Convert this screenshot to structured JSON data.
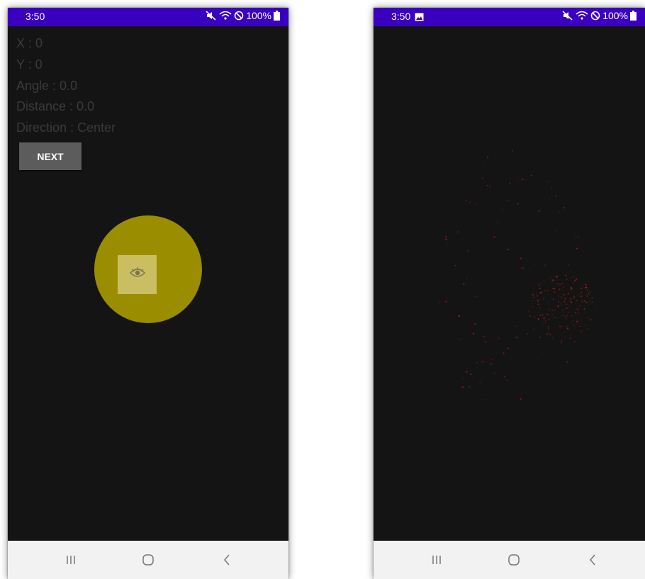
{
  "left_screen": {
    "status_bar": {
      "time": "3:50",
      "battery": "100%"
    },
    "info": {
      "x": "X : 0",
      "y": "Y : 0",
      "angle": "Angle : 0.0",
      "distance": "Distance : 0.0",
      "direction": "Direction : Center"
    },
    "next_button": {
      "label": "NEXT"
    },
    "joystick": {
      "knob_icon": "eye-icon",
      "base_color": "#9a8d00",
      "knob_color": "#c9bf62"
    }
  },
  "right_screen": {
    "status_bar": {
      "time": "3:50",
      "battery": "100%",
      "notification_icon": "gallery-icon"
    }
  },
  "nav_bar": {
    "icons": [
      "recent-apps-icon",
      "home-icon",
      "back-icon"
    ]
  },
  "colors": {
    "status_bar": "#3a00c0",
    "background": "#141414",
    "nav_bar": "#f2f2f2",
    "info_text": "#3a3a3a",
    "button": "#5c5c5c"
  }
}
